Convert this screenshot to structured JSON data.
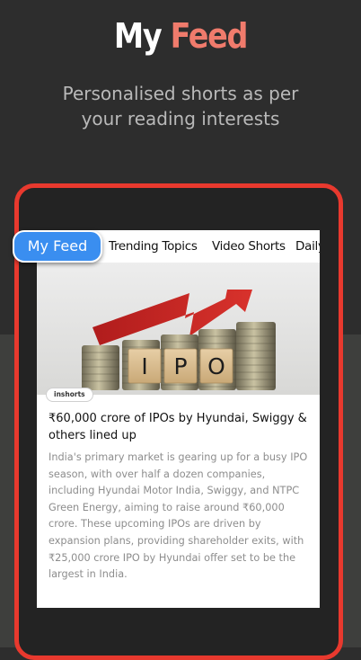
{
  "promo": {
    "headline_part1": "My",
    "headline_part2": "Feed",
    "subtitle_line1": "Personalised shorts as per",
    "subtitle_line2": "your reading interests"
  },
  "tabs": {
    "active": "My Feed",
    "items": [
      "Trending Topics",
      "Video Shorts",
      "Daily"
    ]
  },
  "card": {
    "image_text": [
      "I",
      "P",
      "O"
    ],
    "source_badge": "inshorts",
    "title": "₹60,000 crore of IPOs by Hyundai, Swiggy & others lined up",
    "body": "India's primary market is gearing up for a busy IPO season, with over half a dozen companies, including Hyundai Motor India, Swiggy, and NTPC Green Energy, aiming to raise around ₹60,000 crore. These upcoming IPOs are driven by expansion plans, providing shareholder exits, with ₹25,000 crore IPO by Hyundai offer set to be the largest in India."
  },
  "colors": {
    "accent": "#f07b6c",
    "device_frame": "#e8392e",
    "tab_active": "#3a8ef0",
    "background_top": "#2d2d2d",
    "background_bottom": "#3e3f3d"
  }
}
